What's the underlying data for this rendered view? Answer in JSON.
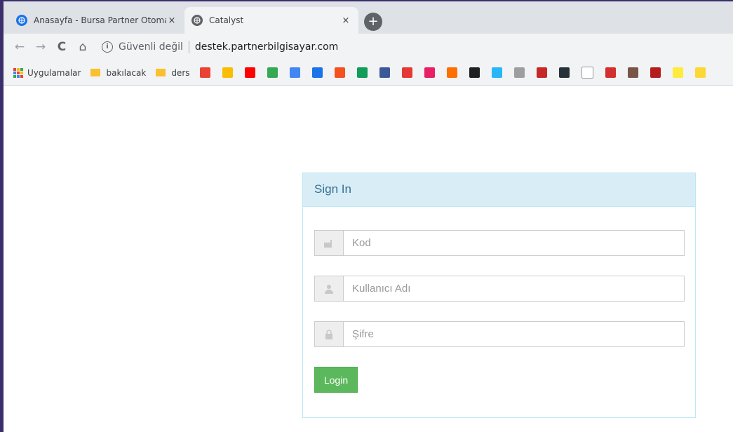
{
  "browser": {
    "tabs": [
      {
        "title": "Anasayfa - Bursa Partner Otomasyon",
        "favicon": "globe-icon",
        "active": false
      },
      {
        "title": "Catalyst",
        "favicon": "globe-icon",
        "active": true
      }
    ],
    "close_glyph": "×",
    "new_tab_glyph": "+",
    "nav": {
      "back": "←",
      "forward": "→",
      "reload": "C",
      "home": "⌂"
    },
    "address": {
      "info_glyph": "i",
      "security_text": "Güvenli değil",
      "url": "destek.partnerbilgisayar.com"
    },
    "bookmarks": {
      "apps_label": "Uygulamalar",
      "folders": [
        "bakılacak",
        "ders"
      ],
      "icon_colors": [
        "#ea4335",
        "#fbbc04",
        "#ff0000",
        "#34a853",
        "#4285f4",
        "#1a73e8",
        "#f4511e",
        "#0f9d58",
        "#3b5998",
        "#e53935",
        "#e91e63",
        "#ff6f00",
        "#212121",
        "#29b6f6",
        "#9e9e9e",
        "#c62828",
        "#263238",
        "#ffffff",
        "#d32f2f",
        "#795548",
        "#b71c1c",
        "#ffeb3b",
        "#fdd835"
      ]
    },
    "colors": {
      "tabstrip": "#dee1e6",
      "toolbar": "#f1f3f4"
    }
  },
  "login": {
    "heading": "Sign In",
    "fields": {
      "code_placeholder": "Kod",
      "username_placeholder": "Kullanıcı Adı",
      "password_placeholder": "Şifre"
    },
    "button_label": "Login",
    "colors": {
      "heading_bg": "#d9edf7",
      "heading_text": "#31708f",
      "button_bg": "#5cb85c"
    }
  }
}
